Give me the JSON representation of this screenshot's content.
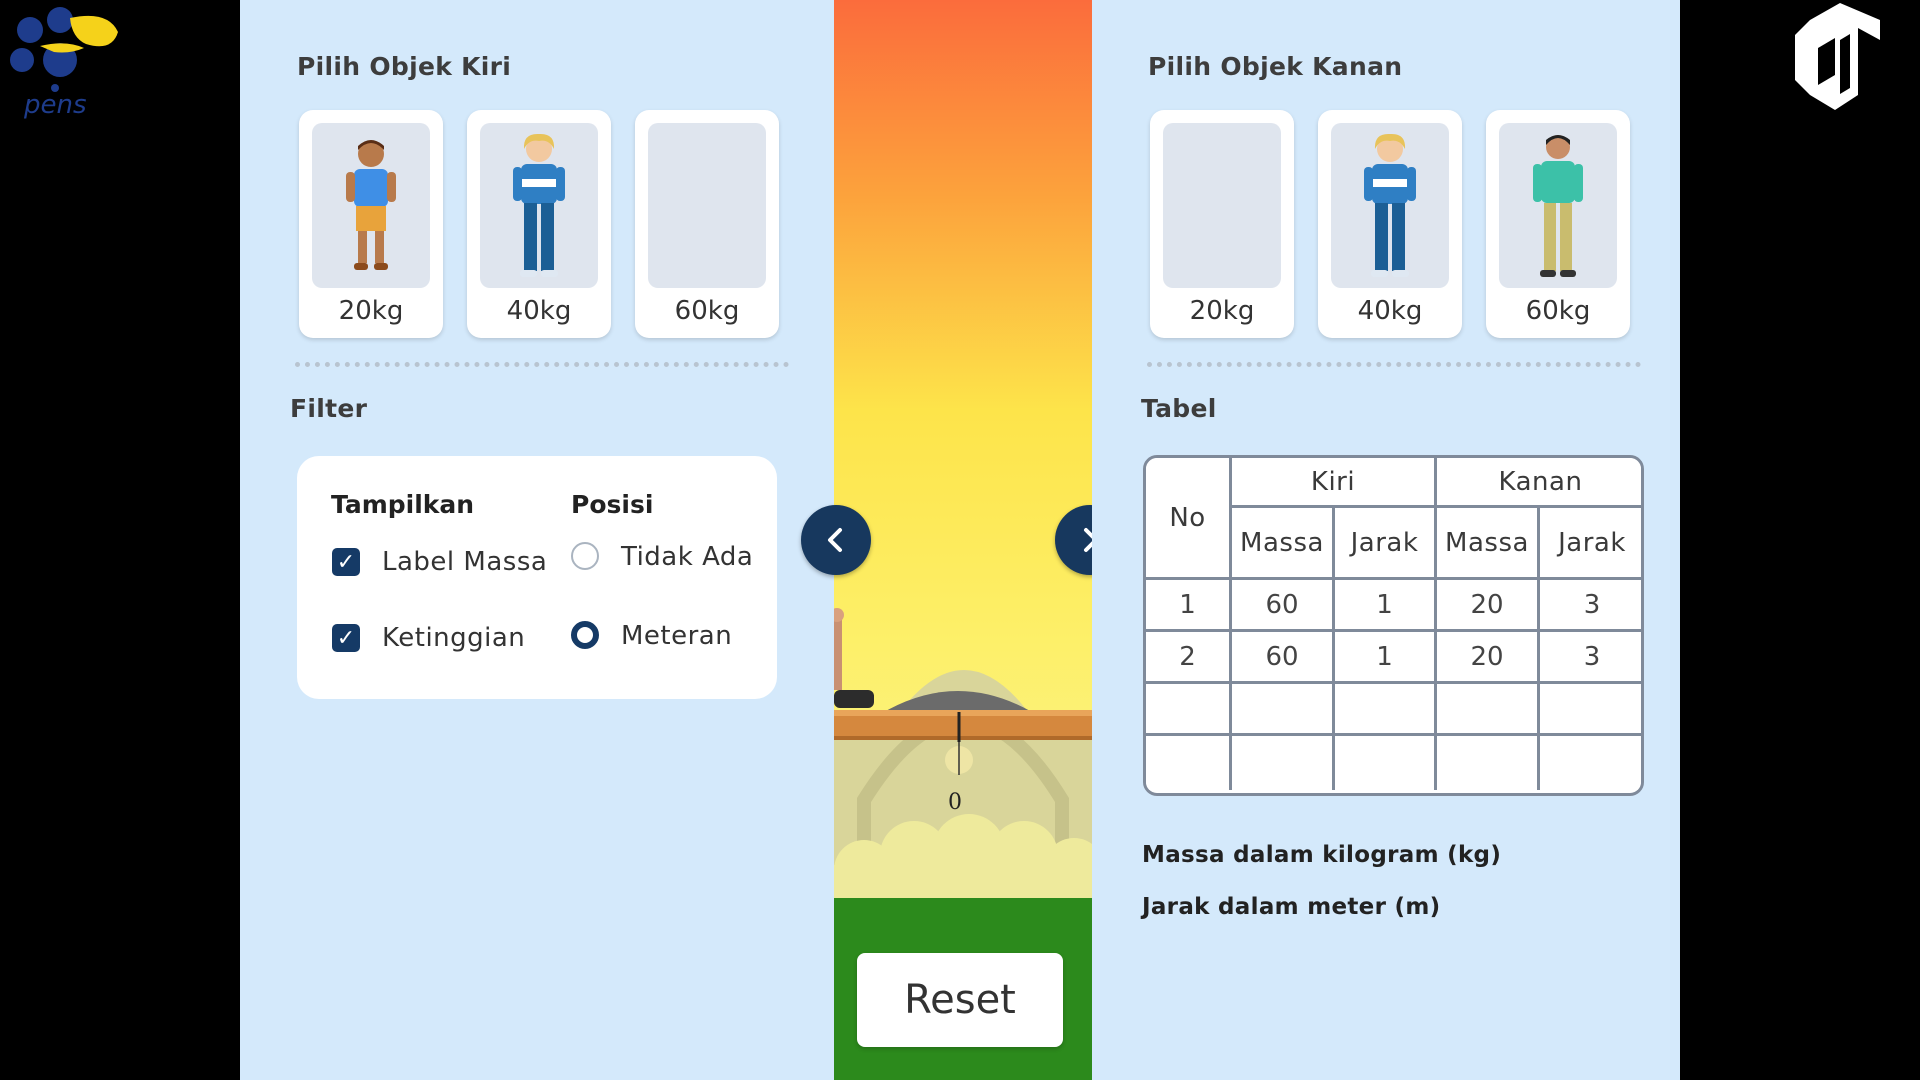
{
  "left_panel": {
    "title": "Pilih Objek Kiri",
    "cards": [
      {
        "label": "20kg",
        "figure": "boy-blue-shirt"
      },
      {
        "label": "40kg",
        "figure": "blonde-kid-striped"
      },
      {
        "label": "60kg",
        "figure": "empty"
      }
    ]
  },
  "right_panel": {
    "title": "Pilih Objek Kanan",
    "cards": [
      {
        "label": "20kg",
        "figure": "empty"
      },
      {
        "label": "40kg",
        "figure": "blonde-kid-striped"
      },
      {
        "label": "60kg",
        "figure": "man-teal-shirt"
      }
    ]
  },
  "filter": {
    "title": "Filter",
    "show_heading": "Tampilkan",
    "position_heading": "Posisi",
    "label_mass": {
      "label": "Label Massa",
      "checked": true
    },
    "height": {
      "label": "Ketinggian",
      "checked": true
    },
    "pos_none": {
      "label": "Tidak Ada",
      "selected": false
    },
    "pos_meter": {
      "label": "Meteran",
      "selected": true
    }
  },
  "scene": {
    "scale_zero": "0",
    "reset_label": "Reset"
  },
  "table": {
    "title": "Tabel",
    "group_left": "Kiri",
    "group_right": "Kanan",
    "col_no": "No",
    "col_mass": "Massa",
    "col_distance": "Jarak",
    "rows": [
      [
        "1",
        "60",
        "1",
        "20",
        "3"
      ],
      [
        "2",
        "60",
        "1",
        "20",
        "3"
      ],
      [
        "",
        "",
        "",
        "",
        ""
      ],
      [
        "",
        "",
        "",
        "",
        ""
      ]
    ]
  },
  "notes": {
    "mass": "Massa dalam kilogram (kg)",
    "distance": "Jarak dalam meter (m)"
  },
  "colors": {
    "panel_bg": "#d4e9fb",
    "accent_navy": "#153a66",
    "ground": "#2c8a1c"
  }
}
